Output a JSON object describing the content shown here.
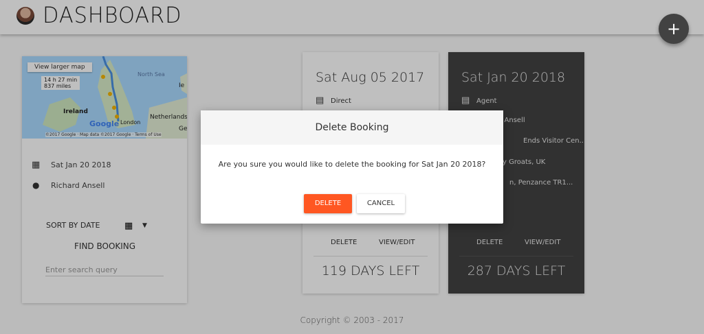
{
  "header": {
    "title": "DASHBOARD",
    "fab_label": "+"
  },
  "sidebar": {
    "map": {
      "view_larger_label": "View larger map",
      "route_time": "14 h 27 min",
      "route_distance": "837 miles",
      "labels": [
        "North Sea",
        "Ireland",
        "Netherlands",
        "London",
        "Ie",
        "Ge"
      ],
      "google_label": "Google",
      "attribution": "©2017 Google · Map data ©2017 Google · Terms of Use"
    },
    "date": "Sat Jan 20 2018",
    "name": "Richard Ansell",
    "sort_label": "SORT BY DATE",
    "find_label": "FIND BOOKING",
    "search_placeholder": "Enter search query",
    "icons": {
      "calendar": "calendar-icon",
      "person": "person-icon",
      "dropdown": "arrow-drop-down-icon"
    }
  },
  "bookings": [
    {
      "date": "Sat Aug 05 2017",
      "type": "Direct",
      "delete_label": "DELETE",
      "edit_label": "VIEW/EDIT",
      "days_left": "119 DAYS LEFT"
    },
    {
      "date": "Sat Jan 20 2018",
      "type": "Agent",
      "line2": "d Ansell",
      "line3": "Ends Visitor Cen...",
      "line4": "y Groats, UK",
      "line5": "n, Penzance TR1...",
      "delete_label": "DELETE",
      "edit_label": "VIEW/EDIT",
      "days_left": "287 DAYS LEFT"
    }
  ],
  "modal": {
    "title": "Delete Booking",
    "message": "Are you sure you would like to delete the booking for Sat Jan 20 2018?",
    "delete_label": "DELETE",
    "cancel_label": "CANCEL"
  },
  "footer": {
    "copyright": "Copyright © 2003 - 2017"
  },
  "colors": {
    "accent": "#ff5722",
    "dark_card": "#424242",
    "fab": "#424242"
  }
}
